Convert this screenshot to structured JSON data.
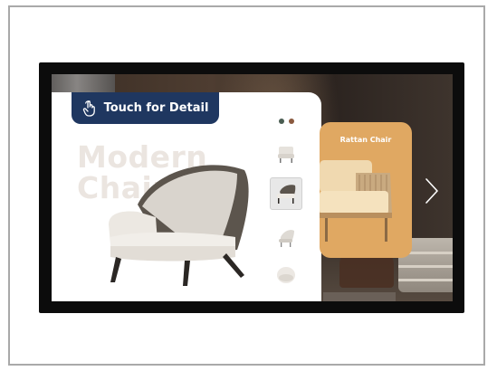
{
  "colors": {
    "touch_button_bg": "#1f3760",
    "rattan_card_bg": "#e0a862",
    "color_dot_1": "#4a5d52",
    "color_dot_2": "#8a5a3f"
  },
  "screen": {
    "touch_button": {
      "label": "Touch for Detail",
      "icon": "hand-pointer-icon"
    },
    "product_title_lines": [
      "Modern",
      "Chair"
    ],
    "rattan_card": {
      "title": "Rattan Chair"
    },
    "next_icon": "chevron-right-icon"
  }
}
